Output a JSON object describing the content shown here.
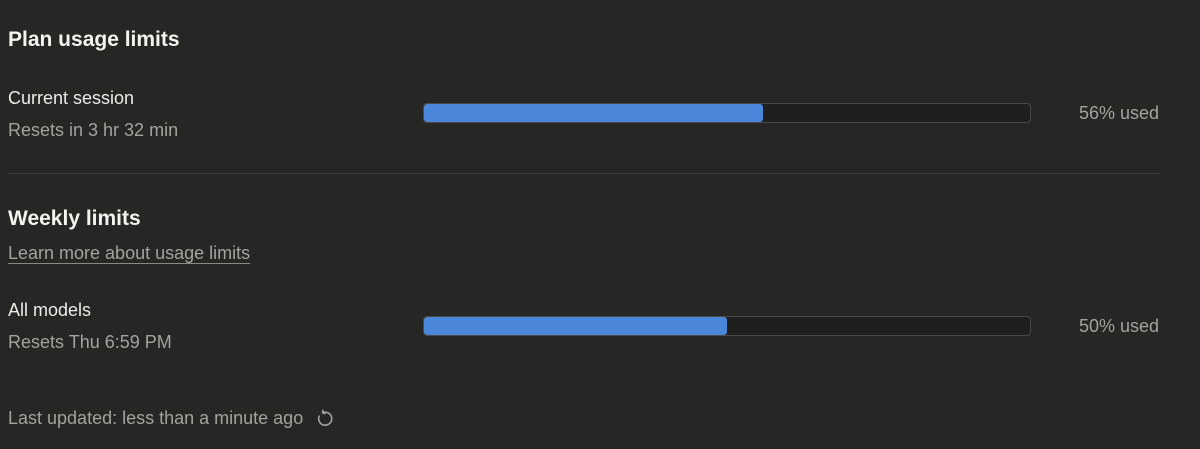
{
  "plan": {
    "title": "Plan usage limits",
    "current_session": {
      "label": "Current session",
      "reset_text": "Resets in 3 hr 32 min",
      "percent": 56,
      "percent_text": "56% used"
    }
  },
  "weekly": {
    "title": "Weekly limits",
    "learn_more": "Learn more about usage limits",
    "all_models": {
      "label": "All models",
      "reset_text": "Resets Thu 6:59 PM",
      "percent": 50,
      "percent_text": "50% used"
    }
  },
  "footer": {
    "last_updated": "Last updated: less than a minute ago",
    "refresh_icon": "refresh-icon"
  },
  "colors": {
    "background": "#262624",
    "bar_fill": "#4a86d9",
    "bar_track": "#1f1f1d"
  }
}
